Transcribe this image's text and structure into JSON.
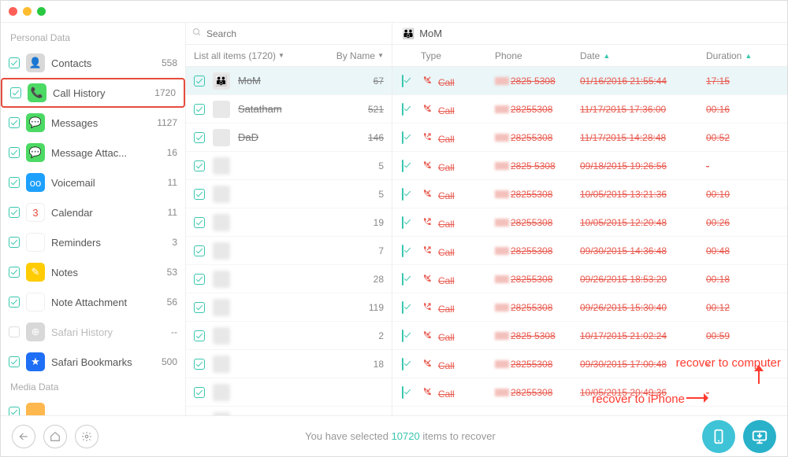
{
  "search": {
    "placeholder": "Search"
  },
  "sidebar": {
    "heading_personal": "Personal Data",
    "heading_media": "Media Data",
    "items": [
      {
        "label": "Contacts",
        "count": "558"
      },
      {
        "label": "Call History",
        "count": "1720"
      },
      {
        "label": "Messages",
        "count": "1127"
      },
      {
        "label": "Message Attac...",
        "count": "16"
      },
      {
        "label": "Voicemail",
        "count": "11"
      },
      {
        "label": "Calendar",
        "count": "11"
      },
      {
        "label": "Reminders",
        "count": "3"
      },
      {
        "label": "Notes",
        "count": "53"
      },
      {
        "label": "Note Attachment",
        "count": "56"
      },
      {
        "label": "Safari History",
        "count": "--"
      },
      {
        "label": "Safari Bookmarks",
        "count": "500"
      }
    ]
  },
  "middle": {
    "header_left": "List all items (1720)",
    "header_right": "By Name",
    "rows": [
      {
        "name": "MoM",
        "count": "67",
        "strike": true,
        "selected": true,
        "emoji": "👪"
      },
      {
        "name": "Satatham",
        "count": "521",
        "strike": true
      },
      {
        "name": "DaD",
        "count": "146",
        "strike": true
      },
      {
        "name": "",
        "count": "5",
        "blur": true
      },
      {
        "name": "",
        "count": "5",
        "blur": true
      },
      {
        "name": "",
        "count": "19",
        "blur": true
      },
      {
        "name": "",
        "count": "7",
        "blur": true
      },
      {
        "name": "",
        "count": "28",
        "blur": true
      },
      {
        "name": "",
        "count": "119",
        "blur": true
      },
      {
        "name": "",
        "count": "2",
        "blur": true
      },
      {
        "name": "",
        "count": "18",
        "blur": true
      },
      {
        "name": "",
        "count": "",
        "blur": true
      },
      {
        "name": "",
        "count": "",
        "blur": true
      }
    ]
  },
  "details": {
    "title": "MoM",
    "cols": {
      "type": "Type",
      "phone": "Phone",
      "date": "Date",
      "duration": "Duration"
    },
    "rows": [
      {
        "type": "Call",
        "icon": "in",
        "phone": "2825 5308",
        "date": "01/16/2016 21:55:44",
        "dur": "17:15",
        "selected": true
      },
      {
        "type": "Call",
        "icon": "in",
        "phone": "28255308",
        "date": "11/17/2015 17:36:00",
        "dur": "00:16"
      },
      {
        "type": "Call",
        "icon": "out",
        "phone": "28255308",
        "date": "11/17/2015 14:28:48",
        "dur": "00:52"
      },
      {
        "type": "Call",
        "icon": "in",
        "phone": "2825 5308",
        "date": "09/18/2015 19:26:56",
        "dur": "-"
      },
      {
        "type": "Call",
        "icon": "in",
        "phone": "28255308",
        "date": "10/05/2015 13:21:36",
        "dur": "00:10"
      },
      {
        "type": "Call",
        "icon": "out",
        "phone": "28255308",
        "date": "10/05/2015 12:20:48",
        "dur": "00:26"
      },
      {
        "type": "Call",
        "icon": "out",
        "phone": "28255308",
        "date": "09/30/2015 14:36:48",
        "dur": "00:48"
      },
      {
        "type": "Call",
        "icon": "in",
        "phone": "28255308",
        "date": "09/26/2015 18:53:20",
        "dur": "00:18"
      },
      {
        "type": "Call",
        "icon": "out",
        "phone": "28255308",
        "date": "09/26/2015 15:30:40",
        "dur": "00:12"
      },
      {
        "type": "Call",
        "icon": "in",
        "phone": "2825 5308",
        "date": "10/17/2015 21:02:24",
        "dur": "00:59"
      },
      {
        "type": "Call",
        "icon": "in",
        "phone": "28255308",
        "date": "09/30/2015 17:00:48",
        "dur": "-"
      },
      {
        "type": "Call",
        "icon": "in",
        "phone": "28255308",
        "date": "10/05/2015 20:49:36",
        "dur": "-"
      }
    ]
  },
  "footer": {
    "msg_pre": "You have selected ",
    "count": "10720",
    "msg_post": " items to recover"
  },
  "annotations": {
    "iphone": "recover to iPhone",
    "computer": "recover to computer"
  }
}
